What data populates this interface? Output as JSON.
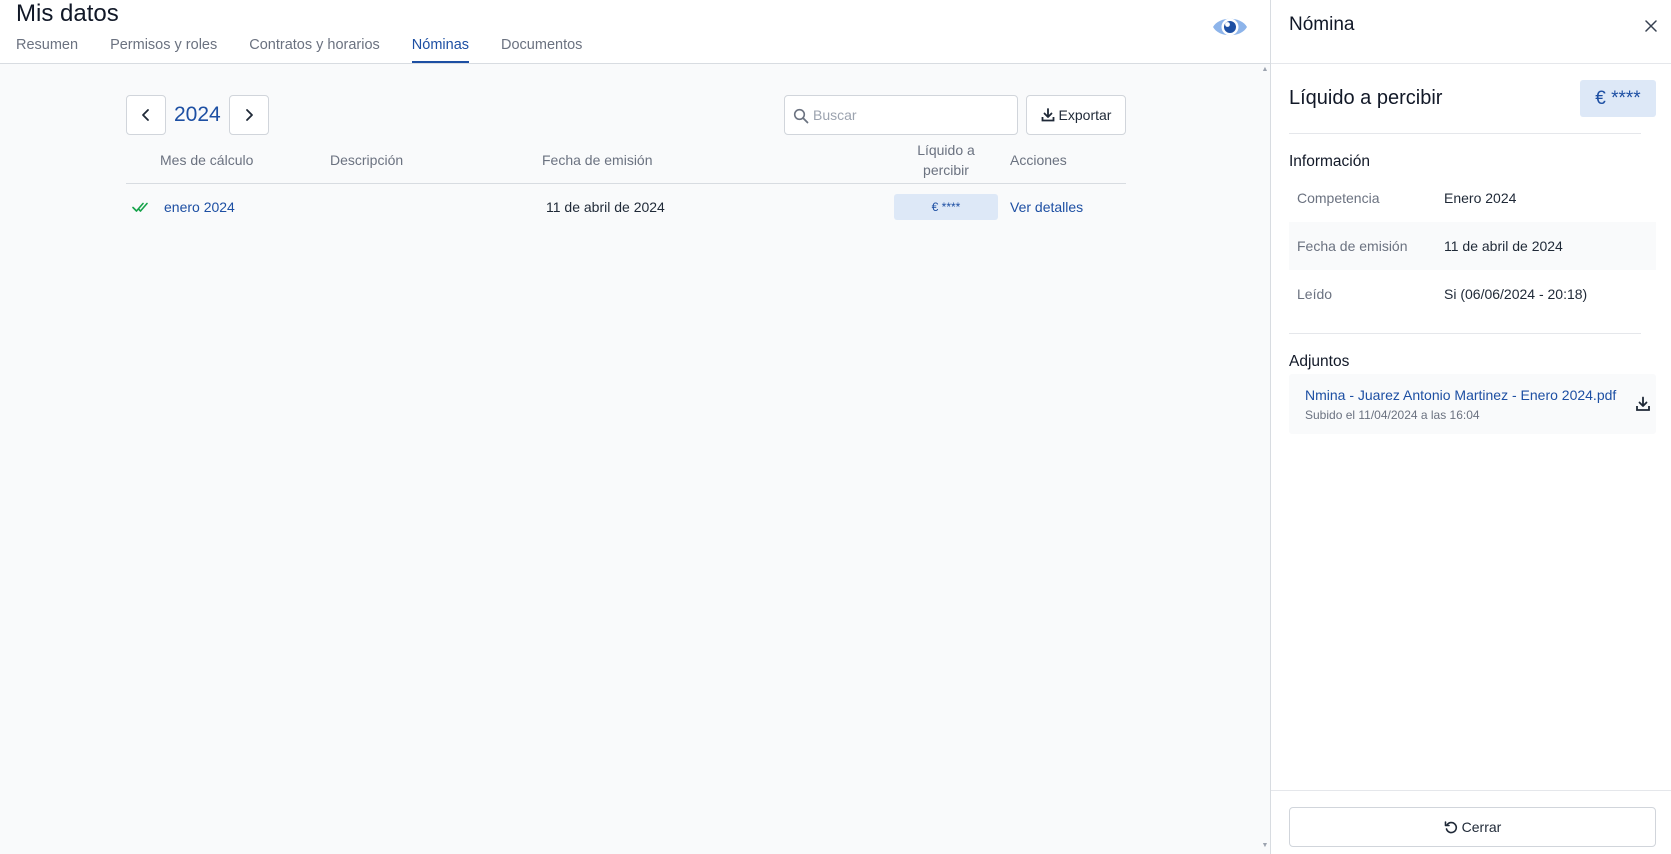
{
  "header": {
    "title": "Mis datos",
    "tabs": [
      {
        "label": "Resumen"
      },
      {
        "label": "Permisos y roles"
      },
      {
        "label": "Contratos y horarios"
      },
      {
        "label": "Nóminas"
      },
      {
        "label": "Documentos"
      }
    ],
    "active_tab": "Nóminas",
    "visibility_icon": "eye-icon"
  },
  "toolbar": {
    "year": "2024",
    "prev_icon": "chevron-left-icon",
    "next_icon": "chevron-right-icon",
    "search_placeholder": "Buscar",
    "search_value": "",
    "export_label": "Exportar"
  },
  "table": {
    "columns": {
      "month": "Mes de cálculo",
      "description": "Descripción",
      "issue_date": "Fecha de emisión",
      "net_line1": "Líquido a",
      "net_line2": "percibir",
      "actions": "Acciones"
    },
    "rows": [
      {
        "status_icon": "check-double-icon",
        "month": "enero 2024",
        "description": "",
        "issue_date": "11 de abril de 2024",
        "net": "€ ****",
        "action": "Ver detalles"
      }
    ]
  },
  "panel": {
    "title": "Nómina",
    "net_label": "Líquido a percibir",
    "net_value": "€ ****",
    "info_title": "Información",
    "info_rows": [
      {
        "key": "Competencia",
        "value": "Enero 2024"
      },
      {
        "key": "Fecha de emisión",
        "value": "11 de abril de 2024"
      },
      {
        "key": "Leído",
        "value": "Si (06/06/2024 - 20:18)"
      }
    ],
    "attachments_title": "Adjuntos",
    "attachments": [
      {
        "name": "Nmina - Juarez Antonio Martinez - Enero 2024.pdf",
        "meta": "Subido el 11/04/2024 a las 16:04"
      }
    ],
    "close_label": "Cerrar"
  },
  "colors": {
    "accent": "#1d4fa3",
    "badge_bg": "#dde8f7",
    "success": "#16a34a"
  }
}
